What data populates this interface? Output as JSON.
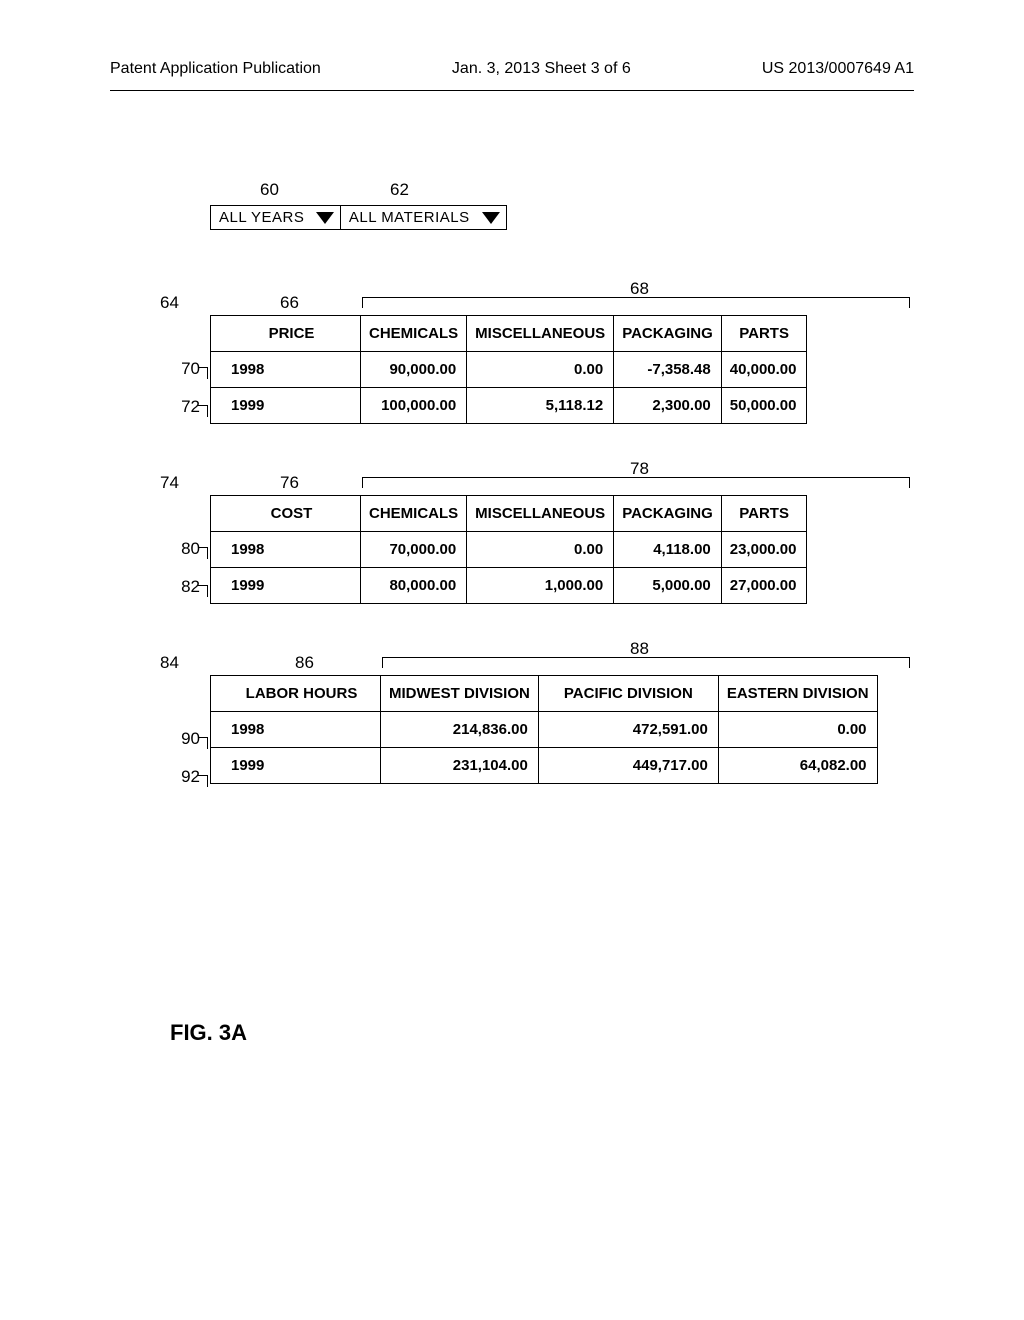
{
  "header": {
    "left": "Patent Application Publication",
    "center": "Jan. 3, 2013  Sheet 3 of 6",
    "right": "US 2013/0007649 A1"
  },
  "dropdowns": {
    "years": "ALL YEARS",
    "materials": "ALL MATERIALS"
  },
  "refs": {
    "dd_years": "60",
    "dd_materials": "62",
    "t1_block": "64",
    "t1_corner": "66",
    "t1_cols": "68",
    "t1_r1": "70",
    "t1_r2": "72",
    "t2_block": "74",
    "t2_corner": "76",
    "t2_cols": "78",
    "t2_r1": "80",
    "t2_r2": "82",
    "t3_block": "84",
    "t3_corner": "86",
    "t3_cols": "88",
    "t3_r1": "90",
    "t3_r2": "92"
  },
  "table1": {
    "corner": "PRICE",
    "cols": [
      "CHEMICALS",
      "MISCELLANEOUS",
      "PACKAGING",
      "PARTS"
    ],
    "rows": [
      {
        "label": "1998",
        "vals": [
          "90,000.00",
          "0.00",
          "-7,358.48",
          "40,000.00"
        ]
      },
      {
        "label": "1999",
        "vals": [
          "100,000.00",
          "5,118.12",
          "2,300.00",
          "50,000.00"
        ]
      }
    ]
  },
  "table2": {
    "corner": "COST",
    "cols": [
      "CHEMICALS",
      "MISCELLANEOUS",
      "PACKAGING",
      "PARTS"
    ],
    "rows": [
      {
        "label": "1998",
        "vals": [
          "70,000.00",
          "0.00",
          "4,118.00",
          "23,000.00"
        ]
      },
      {
        "label": "1999",
        "vals": [
          "80,000.00",
          "1,000.00",
          "5,000.00",
          "27,000.00"
        ]
      }
    ]
  },
  "table3": {
    "corner": "LABOR HOURS",
    "cols": [
      "MIDWEST DIVISION",
      "PACIFIC DIVISION",
      "EASTERN DIVISION"
    ],
    "rows": [
      {
        "label": "1998",
        "vals": [
          "214,836.00",
          "472,591.00",
          "0.00"
        ]
      },
      {
        "label": "1999",
        "vals": [
          "231,104.00",
          "449,717.00",
          "64,082.00"
        ]
      }
    ]
  },
  "figure_label": "FIG. 3A"
}
